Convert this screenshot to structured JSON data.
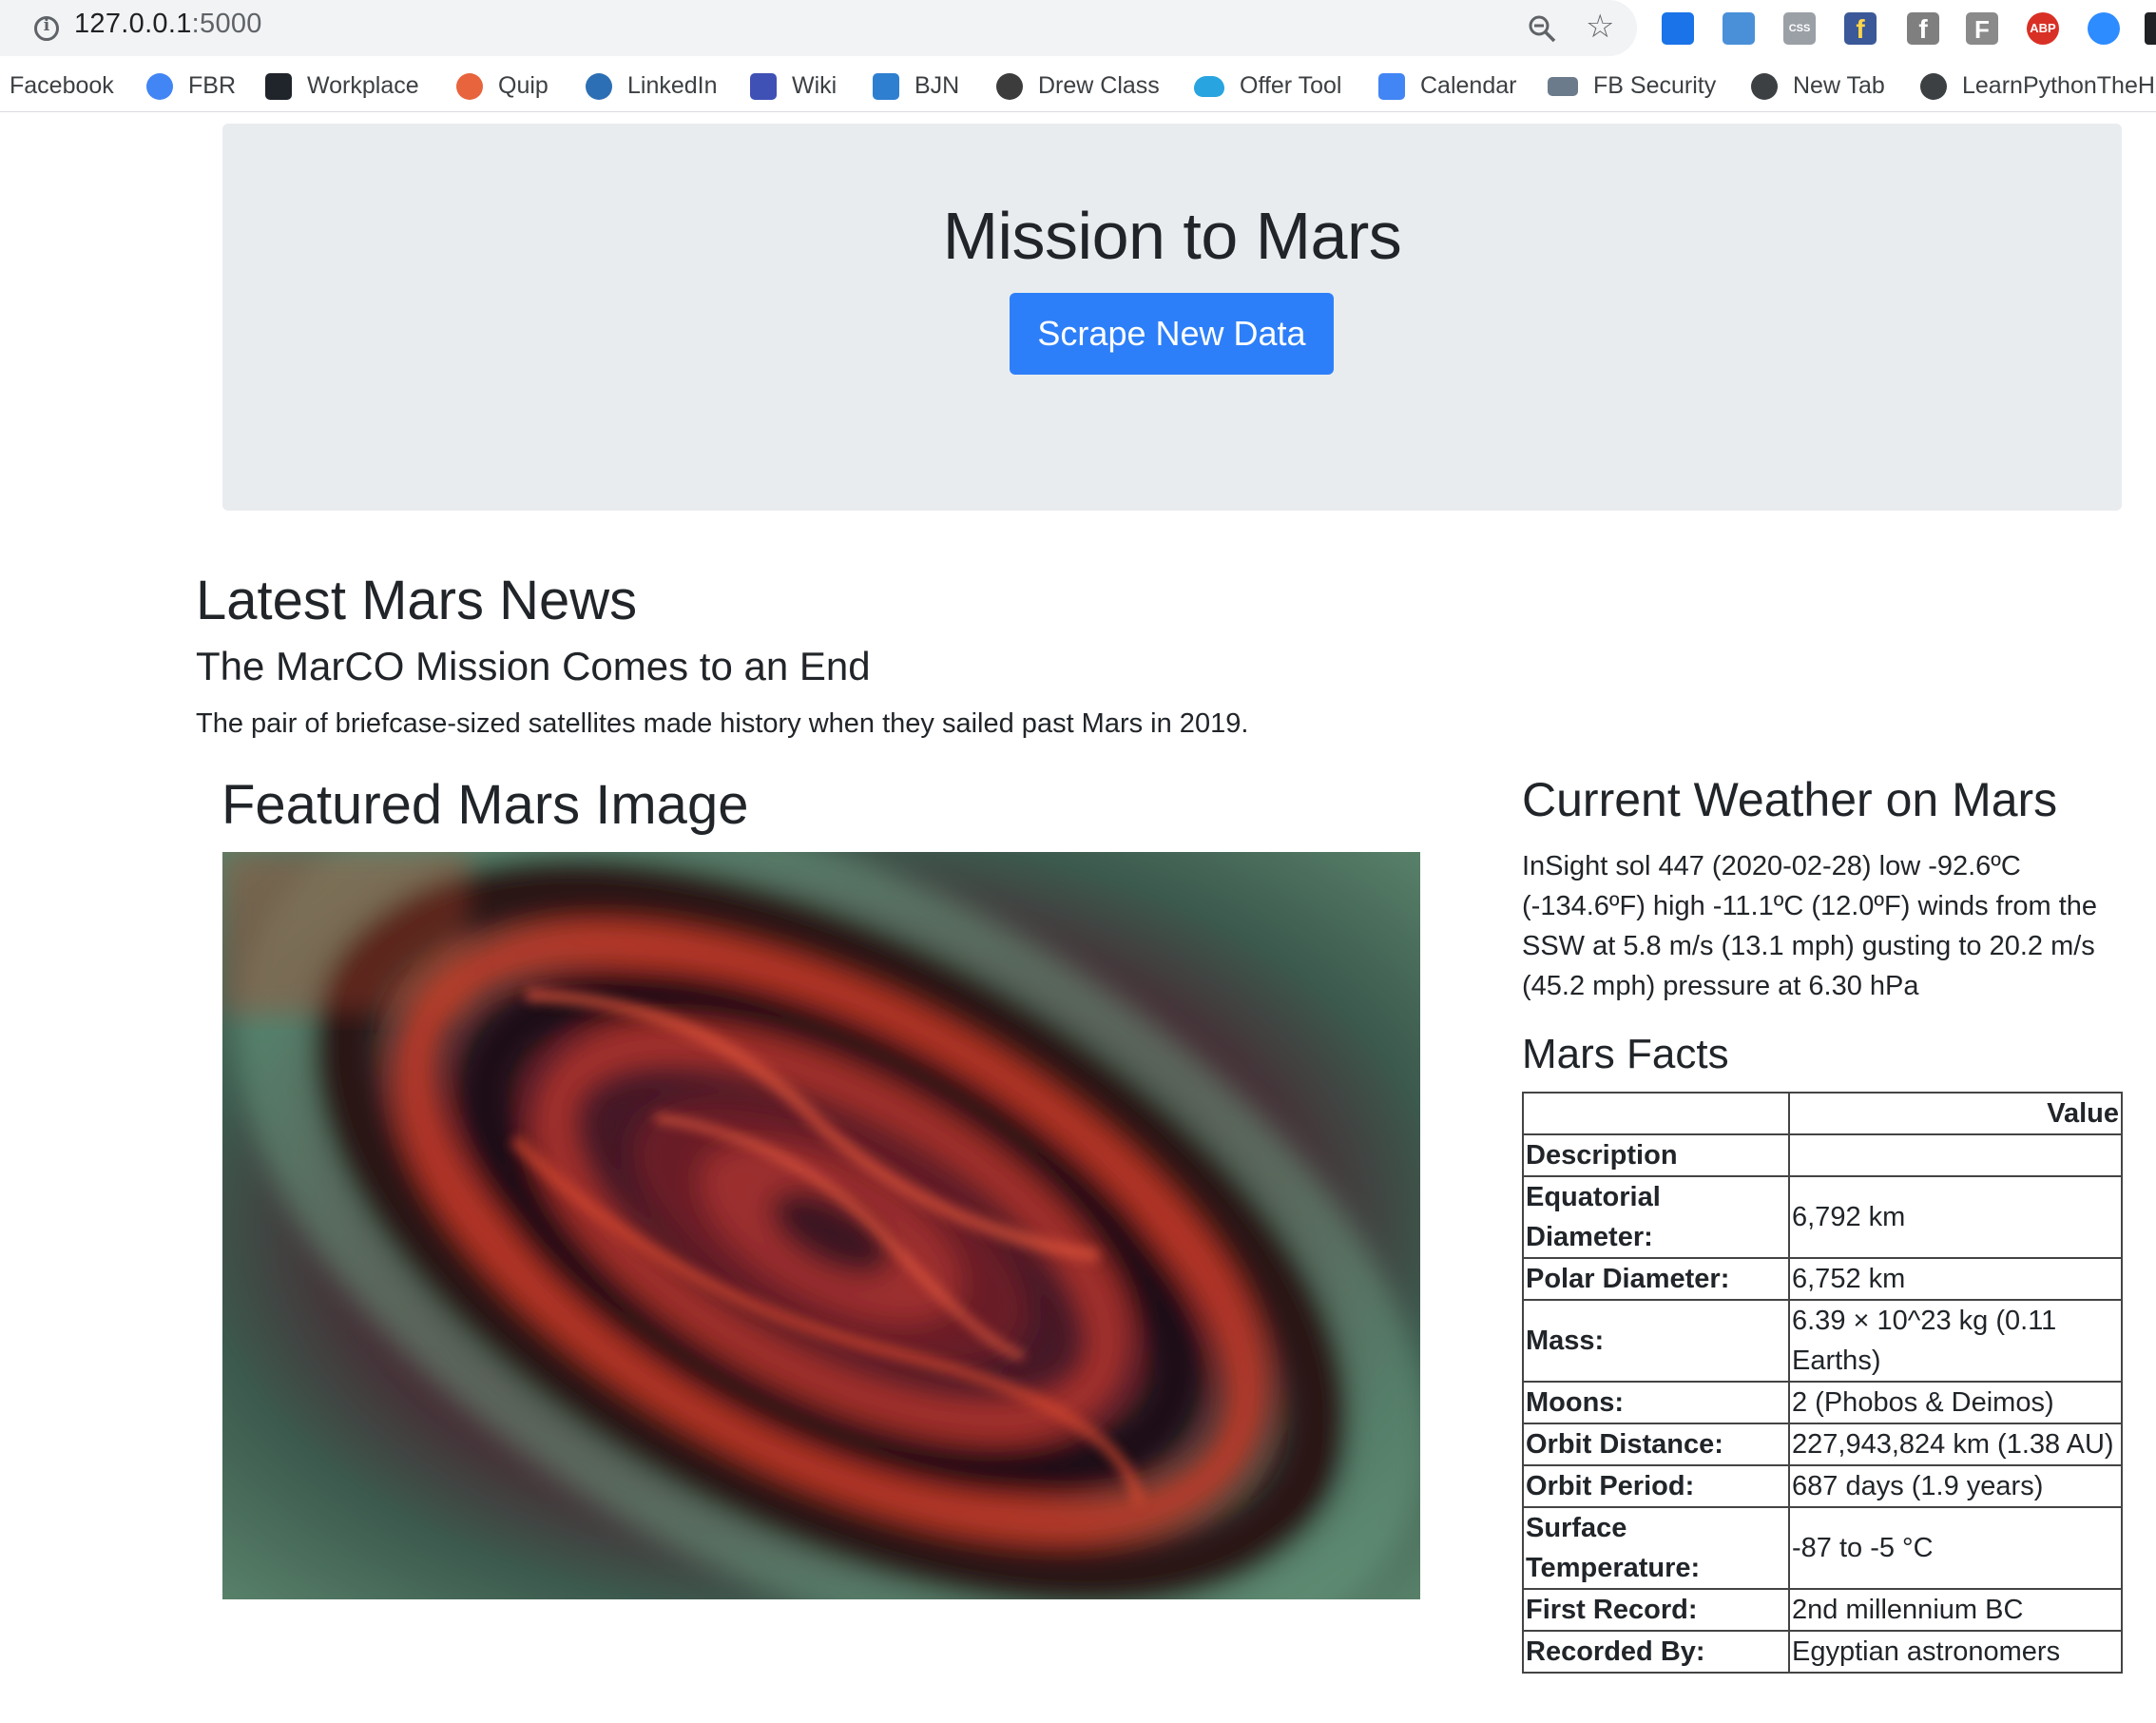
{
  "browser": {
    "url_host": "127.0.0.1",
    "url_port": ":5000",
    "bookmarks": [
      {
        "label": "Facebook",
        "icon": "facebook-icon",
        "color": "#ffffff"
      },
      {
        "label": "FBR",
        "icon": "fbr-icon",
        "color": "#4285f4"
      },
      {
        "label": "Workplace",
        "icon": "workplace-icon",
        "color": "#20252b"
      },
      {
        "label": "Quip",
        "icon": "quip-icon",
        "color": "#e7643c"
      },
      {
        "label": "LinkedIn",
        "icon": "linkedin-icon",
        "color": "#2d6fb4"
      },
      {
        "label": "Wiki",
        "icon": "wiki-icon",
        "color": "#3f51b5"
      },
      {
        "label": "BJN",
        "icon": "bjn-icon",
        "color": "#2f7fd0"
      },
      {
        "label": "Drew Class",
        "icon": "drew-class-icon",
        "color": "#3c3c3c"
      },
      {
        "label": "Offer Tool",
        "icon": "salesforce-cloud-icon",
        "color": "#28a4e0"
      },
      {
        "label": "Calendar",
        "icon": "calendar-icon",
        "color": "#4285f4"
      },
      {
        "label": "FB Security",
        "icon": "fb-security-icon",
        "color": "#6b7b8c"
      },
      {
        "label": "New Tab",
        "icon": "globe-icon",
        "color": "#3c4043"
      },
      {
        "label": "LearnPythonTheH",
        "icon": "globe-icon",
        "color": "#3c4043"
      }
    ]
  },
  "header": {
    "title": "Mission to Mars",
    "scrape_button": "Scrape New Data",
    "button_color": "#2d7ff9"
  },
  "news": {
    "heading": "Latest Mars News",
    "title": "The MarCO Mission Comes to an End",
    "paragraph": "The pair of briefcase-sized satellites made history when they sailed past Mars in 2019."
  },
  "featured": {
    "heading": "Featured Mars Image"
  },
  "weather": {
    "heading": "Current Weather on Mars",
    "text": "InSight sol 447 (2020-02-28) low -92.6ºC (-134.6ºF) high -11.1ºC (12.0ºF) winds from the SSW at 5.8 m/s (13.1 mph) gusting to 20.2 m/s (45.2 mph) pressure at 6.30 hPa"
  },
  "facts": {
    "heading": "Mars Facts",
    "value_header": "Value",
    "index_header": "Description",
    "rows": [
      {
        "label": "Equatorial Diameter:",
        "value": "6,792 km"
      },
      {
        "label": "Polar Diameter:",
        "value": "6,752 km"
      },
      {
        "label": "Mass:",
        "value": "6.39 × 10^23 kg (0.11 Earths)"
      },
      {
        "label": "Moons:",
        "value": "2 (Phobos & Deimos)"
      },
      {
        "label": "Orbit Distance:",
        "value": "227,943,824 km (1.38 AU)"
      },
      {
        "label": "Orbit Period:",
        "value": "687 days (1.9 years)"
      },
      {
        "label": "Surface Temperature:",
        "value": "-87 to -5 °C"
      },
      {
        "label": "First Record:",
        "value": "2nd millennium BC"
      },
      {
        "label": "Recorded By:",
        "value": "Egyptian astronomers"
      }
    ]
  }
}
